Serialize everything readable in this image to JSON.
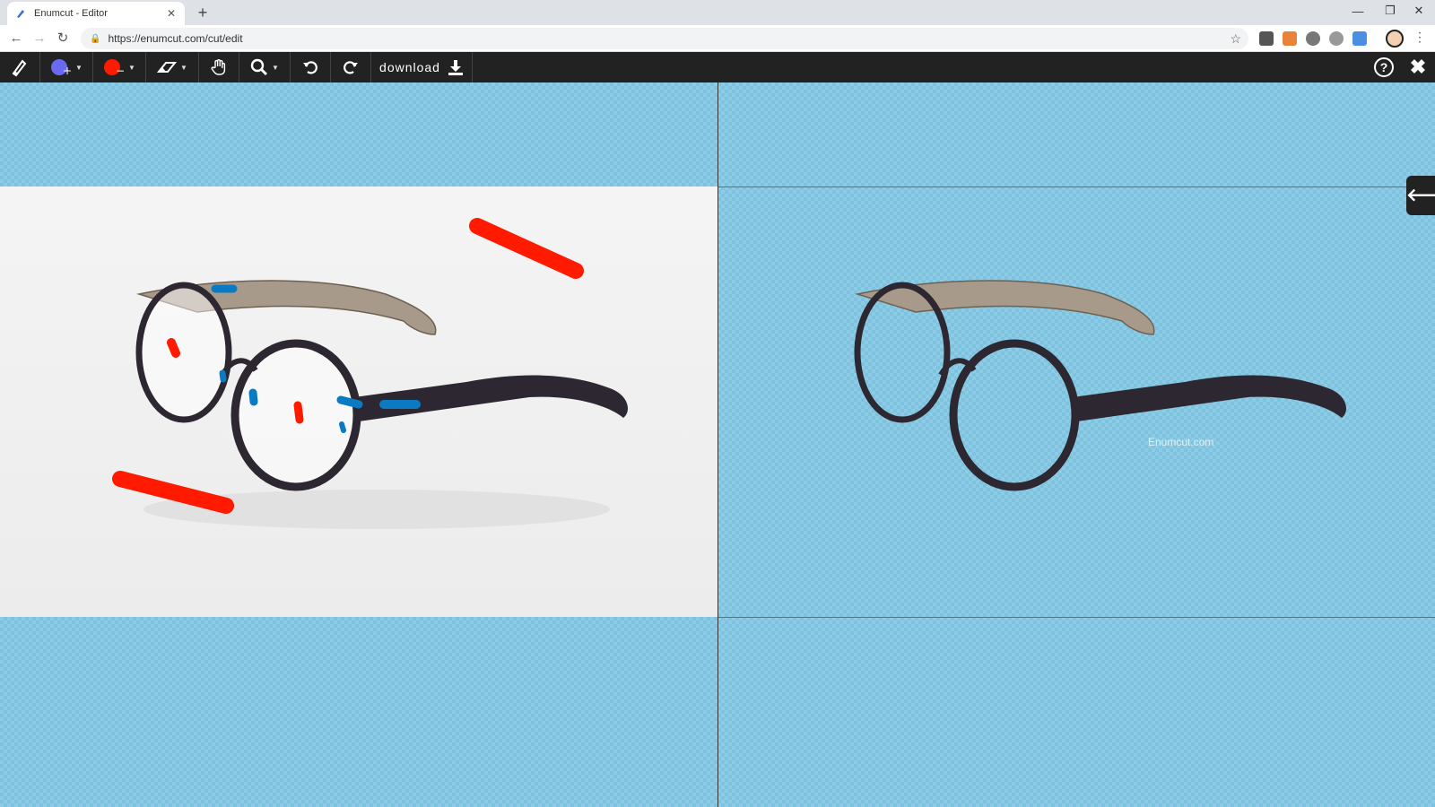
{
  "browser": {
    "tab_title": "Enumcut - Editor",
    "tab_close": "✕",
    "new_tab": "+",
    "url": "https://enumcut.com/cut/edit",
    "window_controls": {
      "minimize": "—",
      "restore": "❐",
      "close": "✕"
    }
  },
  "toolbar": {
    "download_label": "download",
    "help_label": "?",
    "close_label": "✖",
    "colors": {
      "foreground_marker": "#6a6af0",
      "background_marker": "#ff1a00",
      "keep_stroke": "#0a7bc2"
    }
  },
  "editor": {
    "watermark": "Enumcut.com",
    "side_toggle": "🡐"
  }
}
